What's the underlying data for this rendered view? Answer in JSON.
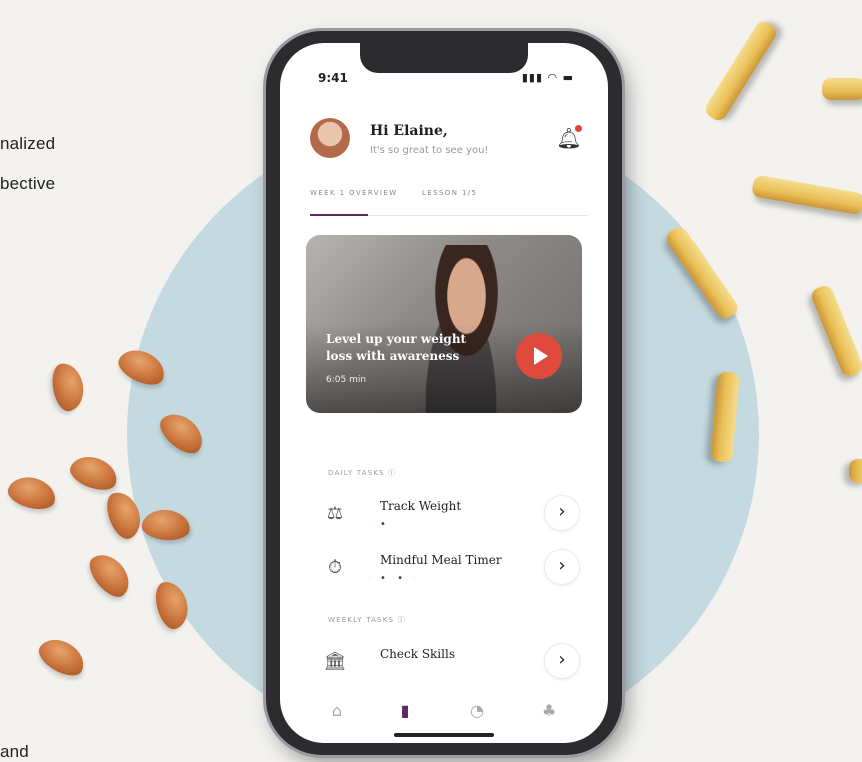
{
  "page": {
    "left_text_lines": [
      "nalized",
      "bective",
      "and"
    ]
  },
  "status_bar": {
    "time": "9:41",
    "icons": "▮▮▮ ◠ ▬"
  },
  "header": {
    "greeting": "Hi Elaine,",
    "subtitle": "It's so great to see you!",
    "notification_icon": "bell-icon"
  },
  "tabs": [
    {
      "label": "WEEK 1 OVERVIEW",
      "active": true
    },
    {
      "label": "LESSON 1/5",
      "active": false
    }
  ],
  "video_card": {
    "title": "Level up your weight loss with awareness",
    "duration": "6:05 min",
    "play_icon": "play-icon"
  },
  "daily_tasks": {
    "label": "DAILY TASKS ⓘ",
    "items": [
      {
        "title": "Track Weight",
        "dots": "•",
        "icon": "scale-icon"
      },
      {
        "title": "Mindful Meal Timer",
        "dots": "• •",
        "icon": "timer-icon"
      }
    ]
  },
  "weekly_tasks": {
    "label": "WEEKLY TASKS ⓘ",
    "items": [
      {
        "title": "Check Skills",
        "dots": "",
        "icon": "building-icon"
      }
    ]
  },
  "bottom_nav": [
    {
      "icon": "home-icon",
      "glyph": "⌂"
    },
    {
      "icon": "book-icon",
      "glyph": "▮"
    },
    {
      "icon": "chart-icon",
      "glyph": "◔"
    },
    {
      "icon": "community-icon",
      "glyph": "♣"
    }
  ],
  "colors": {
    "accent": "#5b2a63",
    "play": "#e04a3c",
    "circle_bg": "#bfd7de"
  }
}
